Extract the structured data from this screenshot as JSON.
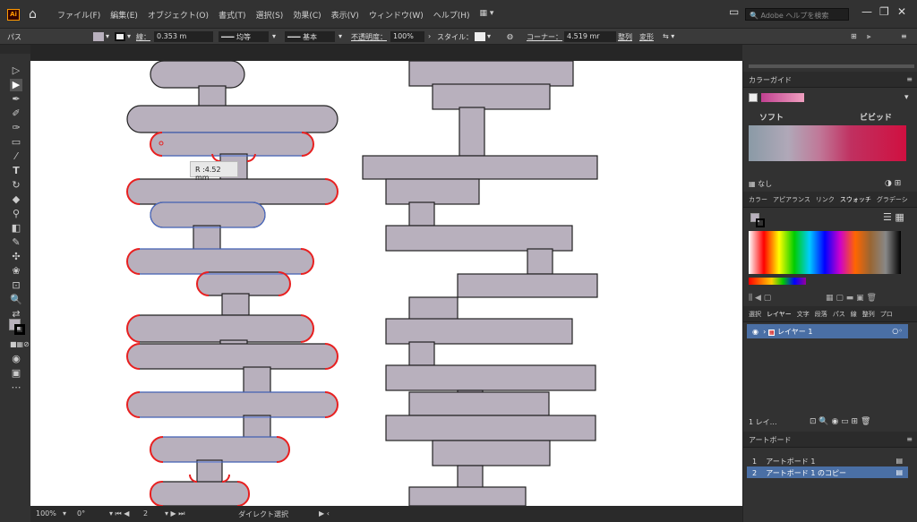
{
  "app": {
    "logo": "Ai"
  },
  "menu": [
    "ファイル(F)",
    "編集(E)",
    "オブジェクト(O)",
    "書式(T)",
    "選択(S)",
    "効果(C)",
    "表示(V)",
    "ウィンドウ(W)",
    "ヘルプ(H)"
  ],
  "search_placeholder": "Adobe ヘルプを検索",
  "control": {
    "mode": "パス",
    "stroke_label": "線：",
    "stroke_value": "0.353 m",
    "profile1": "均等",
    "profile2": "基本",
    "opacity_label": "不透明度：",
    "opacity": "100%",
    "style_label": "スタイル：",
    "corner_label": "コーナー：",
    "corner_value": "4.519 mr",
    "align": "整列",
    "transform": "変形"
  },
  "tooltip": "R :4.52 mm",
  "status": {
    "zoom": "100%",
    "rotation": "0°",
    "artboard": "2",
    "tool": "ダイレクト選択"
  },
  "panels": {
    "color_guide": {
      "title": "カラーガイド",
      "soft": "ソフト",
      "vivid": "ビビッド",
      "none_label": "なし"
    },
    "swatches_tabs": [
      "カラー",
      "アピアランス",
      "リンク",
      "スウォッチ",
      "グラデーシ"
    ],
    "layers_tabs": [
      "選択",
      "レイヤー",
      "文字",
      "段落",
      "パス",
      "線",
      "整列",
      "プロ"
    ],
    "layer_name": "レイヤー 1",
    "layer_count": "1 レイ…",
    "artboards_title": "アートボード",
    "artboards": [
      {
        "num": "1",
        "name": "アートボード 1"
      },
      {
        "num": "2",
        "name": "アートボード 1 のコピー"
      }
    ]
  },
  "colors": {
    "shape_fill": "#b8b0bd",
    "selection_red": "#e82020",
    "selection_blue": "#4a6fd8",
    "accent": "#4a6fa5"
  }
}
